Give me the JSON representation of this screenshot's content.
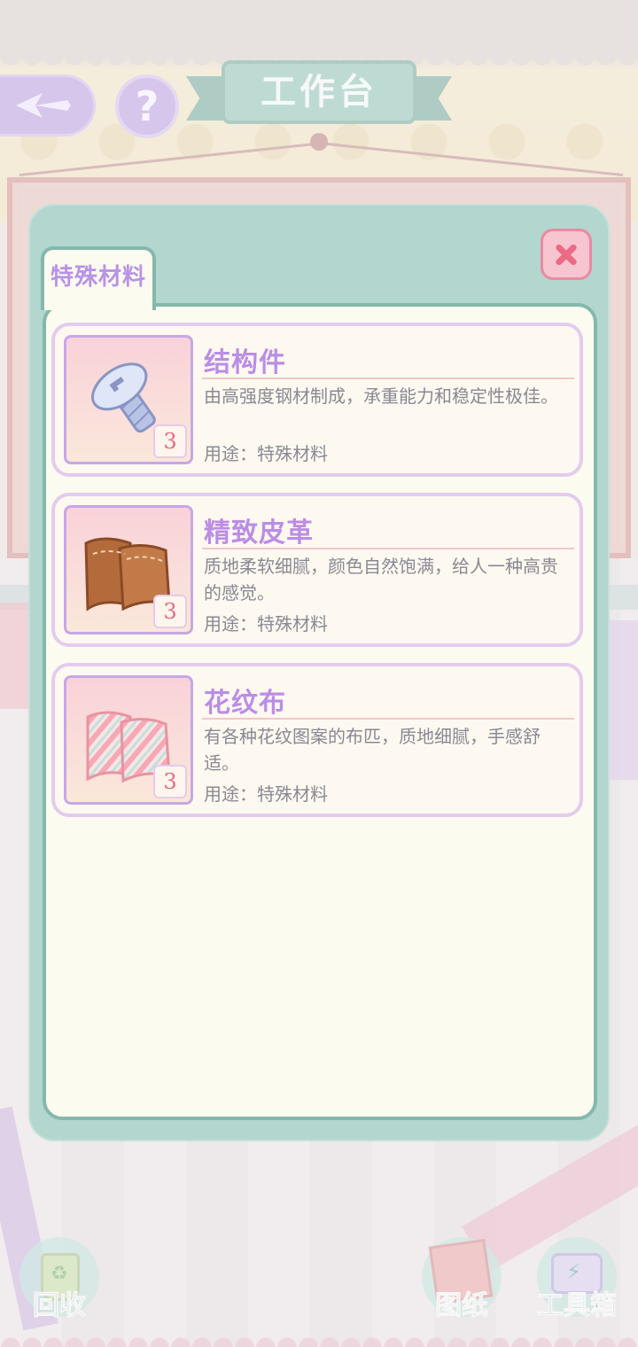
{
  "header": {
    "title": "工作台",
    "help_label": "?"
  },
  "modal": {
    "tab_label": "特殊材料",
    "items": [
      {
        "name": "结构件",
        "description": "由高强度钢材制成，承重能力和稳定性极佳。",
        "usage": "用途：特殊材料",
        "quantity": "3",
        "icon": "screw-icon"
      },
      {
        "name": "精致皮革",
        "description": "质地柔软细腻，颜色自然饱满，给人一种高贵的感觉。",
        "usage": "用途：特殊材料",
        "quantity": "3",
        "icon": "leather-icon"
      },
      {
        "name": "花纹布",
        "description": "有各种花纹图案的布匹，质地细腻，手感舒适。",
        "usage": "用途：特殊材料",
        "quantity": "3",
        "icon": "patterned-cloth-icon"
      }
    ]
  },
  "bottom_nav": {
    "recycle": "回收",
    "blueprint": "图纸",
    "toolbox": "工具箱"
  },
  "colors": {
    "modal_bg": "#b3d6cf",
    "panel_bg": "#fcfbef",
    "title_purple": "#bb8de6",
    "close_pink": "#ec6b84"
  }
}
